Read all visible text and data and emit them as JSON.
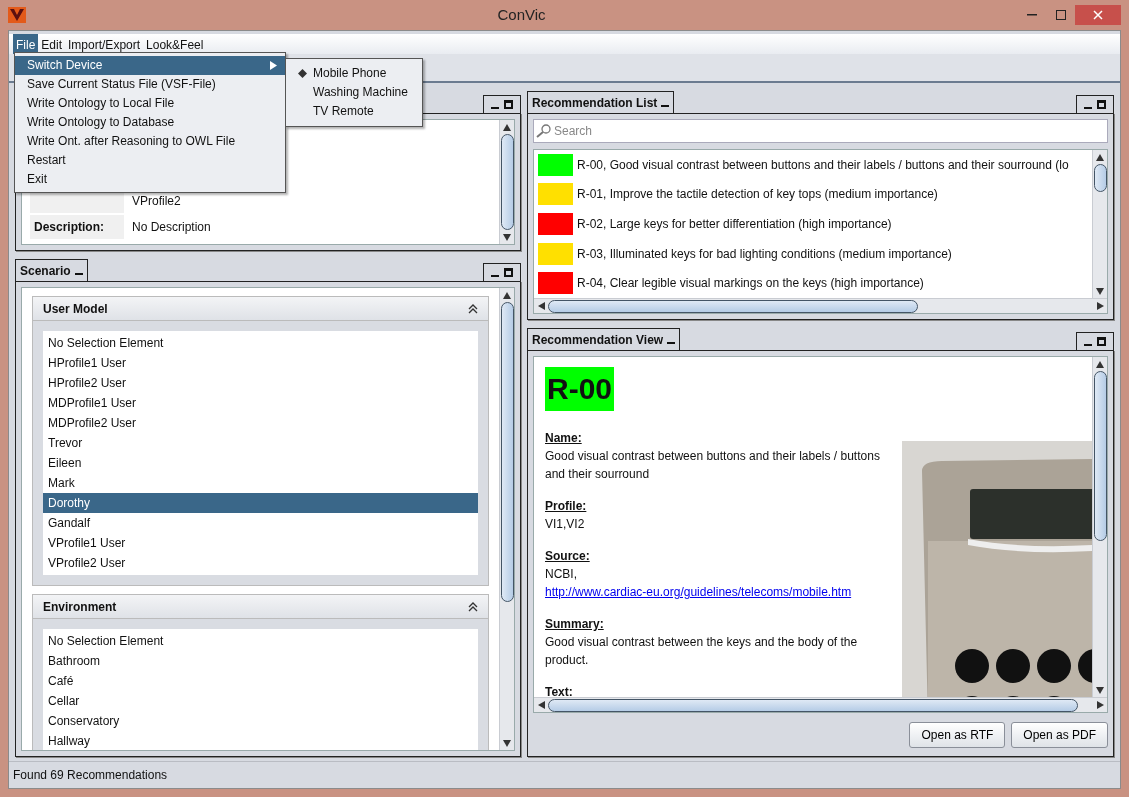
{
  "window": {
    "title": "ConVic"
  },
  "menu_bar": [
    {
      "label": "File",
      "selected": true
    },
    {
      "label": "Edit",
      "selected": false
    },
    {
      "label": "Import/Export",
      "selected": false
    },
    {
      "label": "Look&Feel",
      "selected": false
    }
  ],
  "file_menu": [
    {
      "label": "Switch Device",
      "selected": true,
      "kind": "submenu"
    },
    {
      "label": "Save Current Status File (VSF-File)",
      "selected": false,
      "kind": "item"
    },
    {
      "label": "Write Ontology to Local File",
      "selected": false,
      "kind": "item"
    },
    {
      "label": "Write Ontology to Database",
      "selected": false,
      "kind": "item"
    },
    {
      "label": "Write Ont. after Reasoning to OWL File",
      "selected": false,
      "kind": "item"
    },
    {
      "label": "Restart",
      "selected": false,
      "kind": "item"
    },
    {
      "label": "Exit",
      "selected": false,
      "kind": "item"
    }
  ],
  "device_submenu": [
    {
      "label": "Mobile Phone",
      "selected": true
    },
    {
      "label": "Washing Machine",
      "selected": false
    },
    {
      "label": "TV Remote",
      "selected": false
    }
  ],
  "profile_panel": {
    "rows": [
      {
        "value": "VProfile2"
      },
      {
        "label": "Description:",
        "value": "No Description"
      }
    ]
  },
  "scenario_panel": {
    "title": "Scenario",
    "sections": [
      {
        "title": "User Model",
        "expanded": true,
        "items": [
          {
            "label": "No Selection Element",
            "selected": false
          },
          {
            "label": "HProfile1 User",
            "selected": false
          },
          {
            "label": "HProfile2 User",
            "selected": false
          },
          {
            "label": "MDProfile1 User",
            "selected": false
          },
          {
            "label": "MDProfile2 User",
            "selected": false
          },
          {
            "label": "Trevor",
            "selected": false
          },
          {
            "label": "Eileen",
            "selected": false
          },
          {
            "label": "Mark",
            "selected": false
          },
          {
            "label": "Dorothy",
            "selected": true
          },
          {
            "label": "Gandalf",
            "selected": false
          },
          {
            "label": "VProfile1 User",
            "selected": false
          },
          {
            "label": "VProfile2 User",
            "selected": false
          }
        ]
      },
      {
        "title": "Environment",
        "expanded": true,
        "items": [
          {
            "label": "No Selection Element",
            "selected": false
          },
          {
            "label": "Bathroom",
            "selected": false
          },
          {
            "label": "Café",
            "selected": false
          },
          {
            "label": "Cellar",
            "selected": false
          },
          {
            "label": "Conservatory",
            "selected": false
          },
          {
            "label": "Hallway",
            "selected": false
          }
        ]
      }
    ]
  },
  "recommendation_list": {
    "title": "Recommendation List",
    "search": {
      "placeholder": "Search"
    },
    "items": [
      {
        "text": "R-00, Good visual contrast between buttons and their labels / buttons and their sourround  (lo",
        "color": "#00ff00"
      },
      {
        "text": "R-01, Improve the tactile detection of key tops  (medium importance)",
        "color": "#ffe000"
      },
      {
        "text": "R-02, Large keys for better differentiation  (high importance)",
        "color": "#ff0000"
      },
      {
        "text": "R-03, Illuminated keys for bad lighting conditions  (medium importance)",
        "color": "#ffe000"
      },
      {
        "text": "R-04, Clear legible visual markings on the keys  (high importance)",
        "color": "#ff0000"
      }
    ]
  },
  "recommendation_view": {
    "title": "Recommendation View",
    "heading": "R-00",
    "color": "#00ff00",
    "fields": [
      {
        "label": "Name:",
        "value": "Good visual contrast between buttons and their labels / buttons and their sourround"
      },
      {
        "label": "Profile:",
        "value": "VI1,VI2"
      },
      {
        "label": "Source:",
        "value": "NCBI,",
        "link": "http://www.cardiac-eu.org/guidelines/telecoms/mobile.htm"
      },
      {
        "label": "Summary:",
        "value": "Good visual contrast between the keys and the body of the product."
      },
      {
        "label": "Text:"
      }
    ],
    "picture": {
      "kind": "picture"
    },
    "buttons": [
      "Open as RTF",
      "Open as PDF"
    ]
  },
  "status_bar": "Found 69 Recommendations"
}
